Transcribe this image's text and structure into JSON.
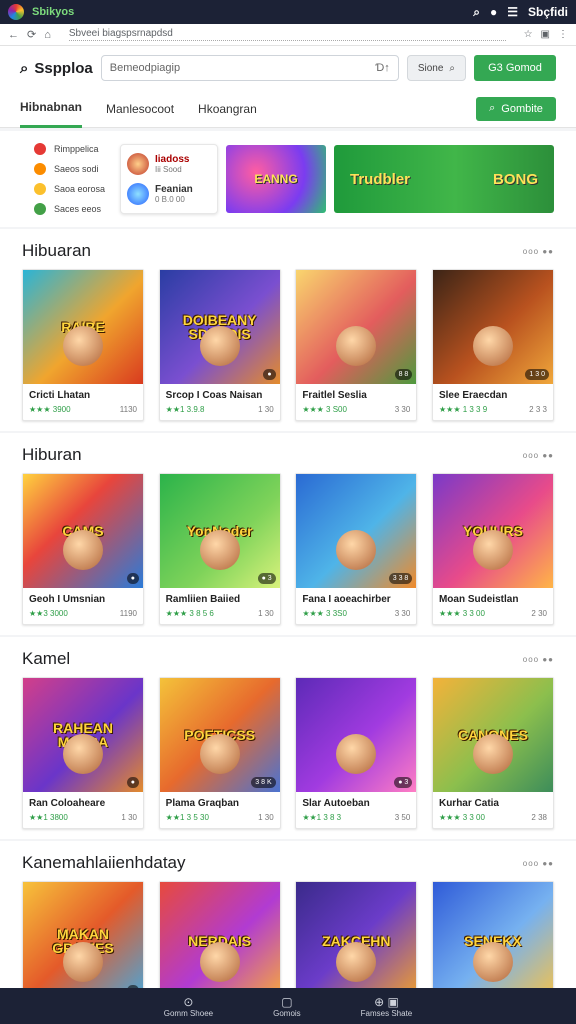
{
  "status": {
    "app_name": "Sbikyos",
    "time": "Sbçfidi",
    "icons": [
      "search-icon",
      "record-icon",
      "menu-icon"
    ]
  },
  "browser": {
    "url": "Sbveei biagspsrnapdsd",
    "icons": [
      "back-icon",
      "refresh-icon",
      "home-icon",
      "bookmark-icon",
      "tabs-icon",
      "more-icon"
    ]
  },
  "header": {
    "brand": "Sspploa",
    "search_placeholder": "Bemeodpiagip",
    "search_shortcut": "Ɗ↑",
    "filter_label": "Sione",
    "cta_label": "G3 Gomod"
  },
  "tabs": [
    {
      "label": "Hibnabnan",
      "active": true
    },
    {
      "label": "Manlesocoot",
      "active": false
    },
    {
      "label": "Hkoangran",
      "active": false
    }
  ],
  "tabs_cta": "Gombite",
  "featured": {
    "categories": [
      {
        "label": "Rimppelica",
        "color": "#e53935"
      },
      {
        "label": "Saeos sodi",
        "color": "#fb8c00"
      },
      {
        "label": "Saoa eorosa",
        "color": "#fbc02d"
      },
      {
        "label": "Saces eeos",
        "color": "#43a047"
      }
    ],
    "mini_list": [
      {
        "title": "Iiadoss",
        "sub": "Iii Sood"
      },
      {
        "title": "Feanian",
        "sub": "0 B.0 00"
      }
    ],
    "banner_left": "EANNG",
    "banner_right_left": "Trudbler",
    "banner_right_right": "BONG"
  },
  "sections": [
    {
      "title": "Hibuaran",
      "more": "ooo ●●",
      "cards": [
        {
          "thumb": "RAIBE",
          "name": "Cricti Lhatan",
          "rating": "★★★ 3900",
          "count": "1130",
          "grad": "linear-gradient(135deg,#2bb4d6,#f0a52e 55%,#d93b1f)",
          "badge": ""
        },
        {
          "thumb": "DOIBEANY SDNEDIS",
          "name": "Srcop I Coas Naisan",
          "rating": "★★1 3.9.8",
          "count": "1 30",
          "grad": "linear-gradient(135deg,#2a3da3,#7a4fd0 55%,#e38b2d)",
          "badge": "●"
        },
        {
          "thumb": "",
          "name": "Fraitlel Seslia",
          "rating": "★★★ 3 S00",
          "count": "3 30",
          "grad": "linear-gradient(135deg,#f9d56e,#e35d5d 55%,#4e9a3e)",
          "badge": "8 8"
        },
        {
          "thumb": "",
          "name": "Slee Eraecdan",
          "rating": "★★★ 1 3 3 9",
          "count": "2 3 3",
          "grad": "linear-gradient(135deg,#3b2416,#b9521f 55%,#f0a73b)",
          "badge": "1 3 0"
        }
      ]
    },
    {
      "title": "Hiburan",
      "more": "ooo ●●",
      "cards": [
        {
          "thumb": "CAMS",
          "name": "Geoh I Umsnian",
          "rating": "★★3 3000",
          "count": "1190",
          "grad": "linear-gradient(135deg,#ffd23f,#e8453c 40%,#2b7bd8)",
          "badge": "●"
        },
        {
          "thumb": "YonNoder",
          "name": "Ramliien Baiied",
          "rating": "★★★ 3 8 5 6",
          "count": "1 30",
          "grad": "linear-gradient(135deg,#2bb34a,#7fd35a 60%,#d9f27c)",
          "badge": "● 3"
        },
        {
          "thumb": "",
          "name": "Fana I aoeachirber",
          "rating": "★★★ 3 3S0",
          "count": "3 30",
          "grad": "linear-gradient(135deg,#2a6ad3,#4fb4e8 55%,#f08a2a)",
          "badge": "3 3 8"
        },
        {
          "thumb": "YOUURS",
          "name": "Moan Sudeistlan",
          "rating": "★★★ 3 3 00",
          "count": "2 30",
          "grad": "linear-gradient(135deg,#7a39c8,#e84b8a 55%,#ffb547)",
          "badge": ""
        }
      ]
    },
    {
      "title": "Kamel",
      "more": "ooo ●●",
      "cards": [
        {
          "thumb": "RAHEAN MSERA",
          "name": "Ran Coloaheare",
          "rating": "★★1 3800",
          "count": "1 30",
          "grad": "linear-gradient(135deg,#d23f8a,#6a35c9 55%,#e38b2d)",
          "badge": "●"
        },
        {
          "thumb": "POETICSS",
          "name": "Plama Graqban",
          "rating": "★★1 3 5 30",
          "count": "1 30",
          "grad": "linear-gradient(135deg,#f4c23a,#e76a2d 50%,#4b73d1)",
          "badge": "3 8 K"
        },
        {
          "thumb": "",
          "name": "Slar Autoeban",
          "rating": "★★1 3 8 3",
          "count": "3 50",
          "grad": "linear-gradient(135deg,#5d2ab7,#a13be0 55%,#ff7ec4)",
          "badge": "● 3"
        },
        {
          "thumb": "CANONES",
          "name": "Kurhar Catia",
          "rating": "★★★ 3 3 00",
          "count": "2 38",
          "grad": "linear-gradient(135deg,#f3b23a,#8cbf4d 55%,#3d8d5a)",
          "badge": ""
        }
      ]
    },
    {
      "title": "Kanemahlaiienhdatay",
      "more": "ooo ●●",
      "cards": [
        {
          "thumb": "MAKAN GRAMES",
          "name": "",
          "rating": "",
          "count": "",
          "grad": "linear-gradient(135deg,#f7c23b,#e45a2a 50%,#4aa6d8)",
          "badge": "●"
        },
        {
          "thumb": "NERDAIS",
          "name": "",
          "rating": "",
          "count": "",
          "grad": "linear-gradient(135deg,#e74a3c,#b13bd2 55%,#f7a93b)",
          "badge": ""
        },
        {
          "thumb": "ZAKCEHN",
          "name": "",
          "rating": "",
          "count": "",
          "grad": "linear-gradient(135deg,#3a2a8a,#6b3cc9 50%,#f0a12d)",
          "badge": ""
        },
        {
          "thumb": "SENEKX",
          "name": "",
          "rating": "",
          "count": "",
          "grad": "linear-gradient(135deg,#2f5bd8,#76b1f0 55%,#f3c24d)",
          "badge": ""
        }
      ]
    }
  ],
  "bottom_nav": [
    {
      "label": "Gomm Shoee",
      "icon": "⊙"
    },
    {
      "label": "Gomois",
      "icon": "▢"
    },
    {
      "label": "Famses Shate",
      "icon": "⊕ ▣"
    }
  ]
}
